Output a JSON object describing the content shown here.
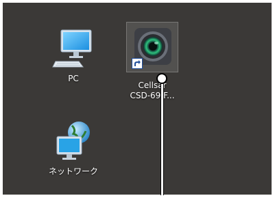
{
  "desktop": {
    "background": "#3b3937",
    "icons": [
      {
        "label": "PC",
        "icon": "pc-monitor-icon"
      },
      {
        "label": "Cellsar\nCSD-69 F...",
        "icon": "camera-lens-icon",
        "shortcut": true
      },
      {
        "label": "ネットワーク",
        "icon": "network-globe-icon"
      }
    ]
  },
  "colors": {
    "monitor_blue": "#29a3e6",
    "lens_green": "#2ec27e",
    "shortcut_arrow": "#1f4e9c"
  }
}
